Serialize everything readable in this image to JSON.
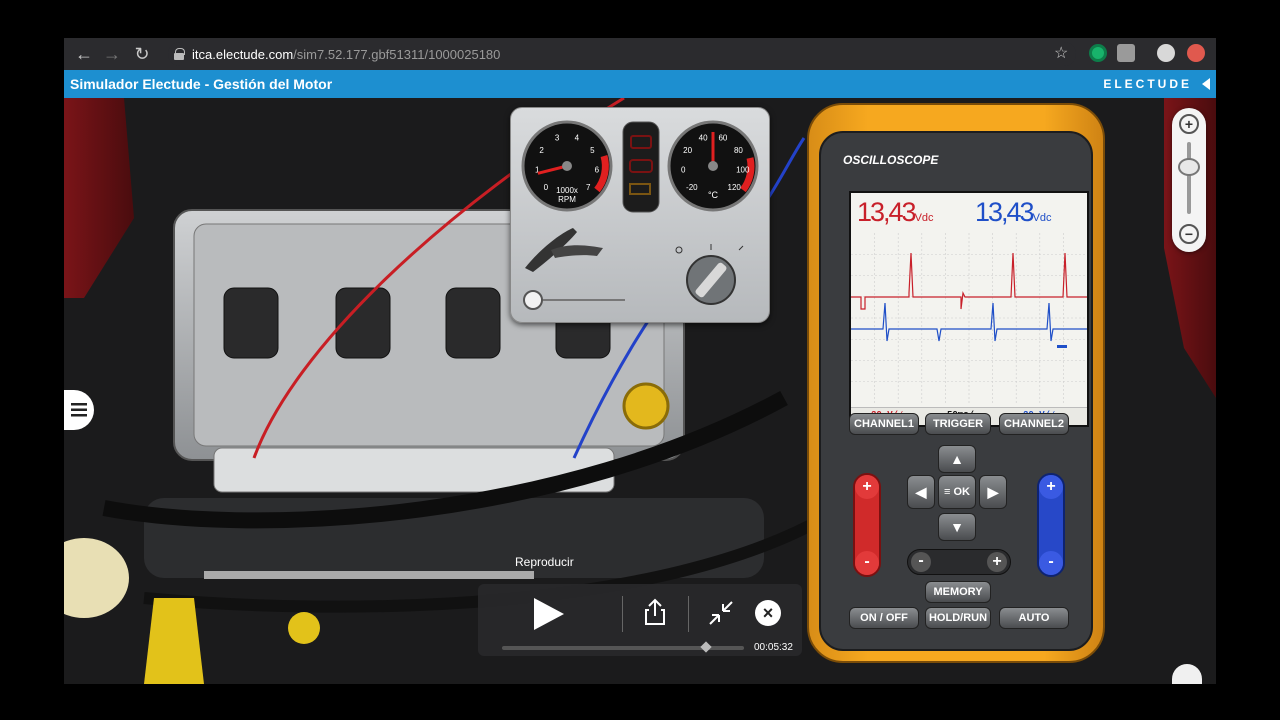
{
  "browser": {
    "url_domain": "itca.electude.com",
    "url_path": "/sim7.52.177.gbf51311/1000025180"
  },
  "app": {
    "title": "Simulador Electude - Gestión del Motor",
    "brand": "ELECTUDE"
  },
  "gauges": {
    "rpm_ticks": [
      "0",
      "1",
      "2",
      "3",
      "4",
      "5",
      "6",
      "7"
    ],
    "rpm_unit_1": "1000x",
    "rpm_unit_2": "RPM",
    "temp_ticks": [
      "-20",
      "0",
      "20",
      "40",
      "60",
      "80",
      "100",
      "120"
    ],
    "temp_unit": "°C",
    "rpm_value": 0.8,
    "temp_value": 50
  },
  "oscilloscope": {
    "title": "OSCILLOSCOPE",
    "ch1_value": "13,43",
    "ch1_unit": "Vdc",
    "ch2_value": "13,43",
    "ch2_unit": "Vdc",
    "ch1_scale": "20 V/⁄",
    "timebase": "50ms/",
    "ch2_scale": "20 V/⁄",
    "buttons": {
      "channel1": "CHANNEL1",
      "trigger": "TRIGGER",
      "channel2": "CHANNEL2",
      "ok": "≡ OK",
      "memory": "MEMORY",
      "onoff": "ON / OFF",
      "holdrun": "HOLD/RUN",
      "auto": "AUTO"
    },
    "colors": {
      "ch1": "#c8202a",
      "ch2": "#1f4fc8",
      "body": "#f6a81f"
    }
  },
  "video": {
    "tooltip": "Reproducir",
    "time": "00:05:32"
  }
}
